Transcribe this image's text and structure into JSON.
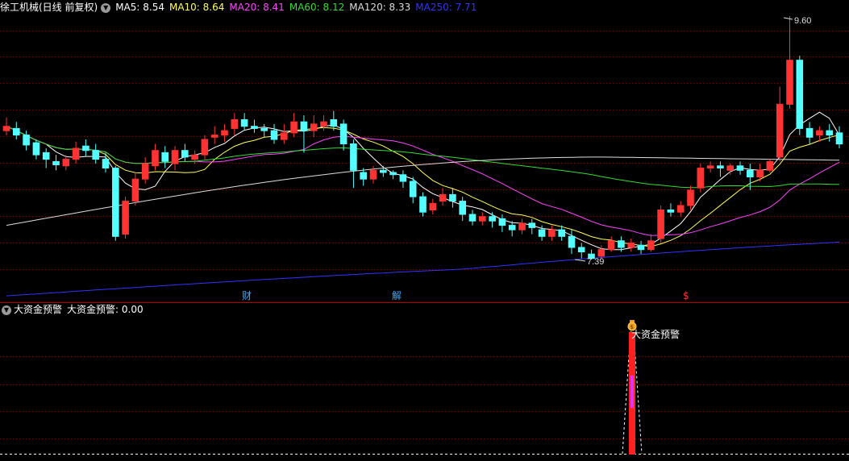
{
  "stock": {
    "title": "徐工机械(日线 前复权)",
    "ma": [
      {
        "label": "MA5: 8.54",
        "color": "#ffffff"
      },
      {
        "label": "MA10: 8.64",
        "color": "#ffff55"
      },
      {
        "label": "MA20: 8.41",
        "color": "#ff44ff"
      },
      {
        "label": "MA60: 8.12",
        "color": "#33dd33"
      },
      {
        "label": "MA120: 8.33",
        "color": "#dddddd"
      },
      {
        "label": "MA250: 7.71",
        "color": "#3333ff"
      }
    ],
    "high_label": "9.60",
    "low_label": "7.39",
    "markers": [
      {
        "text": "财",
        "color": "#3fa8ff"
      },
      {
        "text": "解",
        "color": "#3fa8ff"
      },
      {
        "text": "$",
        "color": "#ff3333"
      }
    ]
  },
  "indicator": {
    "title": "大资金预警",
    "value_label": "大资金预警: 0.00",
    "signal_label": "大资金预警",
    "signal_icon": "money-bag-icon"
  },
  "colors": {
    "up": "#ff3333",
    "down": "#54ffff",
    "grid": "#7a0000",
    "divider": "#b00000"
  },
  "chart_data": {
    "type": "candlestick",
    "price_range": [
      7.2,
      9.7
    ],
    "candles": [
      [
        8.56,
        8.6,
        8.68,
        8.52
      ],
      [
        8.58,
        8.52,
        8.64,
        8.48
      ],
      [
        8.52,
        8.43,
        8.56,
        8.38
      ],
      [
        8.45,
        8.34,
        8.48,
        8.3
      ],
      [
        8.36,
        8.3,
        8.4,
        8.22
      ],
      [
        8.28,
        8.25,
        8.34,
        8.2
      ],
      [
        8.24,
        8.3,
        8.34,
        8.2
      ],
      [
        8.3,
        8.4,
        8.46,
        8.26
      ],
      [
        8.42,
        8.38,
        8.48,
        8.33
      ],
      [
        8.38,
        8.3,
        8.44,
        8.26
      ],
      [
        8.3,
        8.22,
        8.36,
        8.18
      ],
      [
        8.22,
        7.6,
        8.24,
        7.56
      ],
      [
        7.62,
        7.92,
        7.96,
        7.58
      ],
      [
        7.92,
        8.12,
        8.18,
        7.88
      ],
      [
        8.12,
        8.26,
        8.32,
        8.08
      ],
      [
        8.24,
        8.38,
        8.44,
        8.2
      ],
      [
        8.36,
        8.28,
        8.42,
        8.22
      ],
      [
        8.26,
        8.38,
        8.42,
        8.2
      ],
      [
        8.38,
        8.32,
        8.44,
        8.28
      ],
      [
        8.3,
        8.34,
        8.38,
        8.26
      ],
      [
        8.34,
        8.48,
        8.52,
        8.3
      ],
      [
        8.5,
        8.52,
        8.6,
        8.44
      ],
      [
        8.52,
        8.56,
        8.62,
        8.46
      ],
      [
        8.58,
        8.66,
        8.72,
        8.52
      ],
      [
        8.66,
        8.6,
        8.72,
        8.56
      ],
      [
        8.6,
        8.58,
        8.66,
        8.54
      ],
      [
        8.58,
        8.56,
        8.62,
        8.5
      ],
      [
        8.56,
        8.48,
        8.62,
        8.44
      ],
      [
        8.48,
        8.54,
        8.62,
        8.44
      ],
      [
        8.54,
        8.64,
        8.72,
        8.5
      ],
      [
        8.64,
        8.56,
        8.7,
        8.36
      ],
      [
        8.56,
        8.62,
        8.7,
        8.5
      ],
      [
        8.6,
        8.64,
        8.7,
        8.56
      ],
      [
        8.66,
        8.6,
        8.74,
        8.56
      ],
      [
        8.62,
        8.44,
        8.66,
        8.38
      ],
      [
        8.44,
        8.2,
        8.48,
        8.04
      ],
      [
        8.18,
        8.12,
        8.22,
        8.06
      ],
      [
        8.12,
        8.2,
        8.24,
        8.08
      ],
      [
        8.2,
        8.18,
        8.24,
        8.14
      ],
      [
        8.18,
        8.16,
        8.2,
        8.12
      ],
      [
        8.16,
        8.1,
        8.2,
        8.04
      ],
      [
        8.1,
        7.96,
        8.14,
        7.9
      ],
      [
        7.96,
        7.82,
        8.0,
        7.78
      ],
      [
        7.84,
        7.9,
        7.94,
        7.8
      ],
      [
        7.92,
        7.98,
        8.04,
        7.88
      ],
      [
        7.98,
        7.92,
        8.04,
        7.86
      ],
      [
        7.92,
        7.8,
        7.96,
        7.74
      ],
      [
        7.8,
        7.74,
        7.84,
        7.7
      ],
      [
        7.74,
        7.78,
        7.82,
        7.7
      ],
      [
        7.78,
        7.74,
        7.82,
        7.68
      ],
      [
        7.76,
        7.7,
        7.8,
        7.64
      ],
      [
        7.7,
        7.66,
        7.74,
        7.6
      ],
      [
        7.66,
        7.72,
        7.76,
        7.62
      ],
      [
        7.72,
        7.68,
        7.76,
        7.62
      ],
      [
        7.66,
        7.6,
        7.7,
        7.56
      ],
      [
        7.6,
        7.66,
        7.7,
        7.56
      ],
      [
        7.66,
        7.6,
        7.7,
        7.56
      ],
      [
        7.6,
        7.5,
        7.66,
        7.44
      ],
      [
        7.5,
        7.46,
        7.54,
        7.4
      ],
      [
        7.44,
        7.4,
        7.48,
        7.39
      ],
      [
        7.42,
        7.48,
        7.52,
        7.4
      ],
      [
        7.48,
        7.56,
        7.6,
        7.46
      ],
      [
        7.56,
        7.5,
        7.6,
        7.46
      ],
      [
        7.5,
        7.54,
        7.58,
        7.46
      ],
      [
        7.52,
        7.48,
        7.56,
        7.44
      ],
      [
        7.48,
        7.56,
        7.62,
        7.46
      ],
      [
        7.58,
        7.84,
        7.88,
        7.54
      ],
      [
        7.84,
        7.82,
        7.9,
        7.78
      ],
      [
        7.82,
        7.88,
        7.92,
        7.78
      ],
      [
        7.88,
        8.02,
        8.06,
        7.84
      ],
      [
        8.04,
        8.22,
        8.26,
        8.0
      ],
      [
        8.22,
        8.24,
        8.28,
        8.18
      ],
      [
        8.24,
        8.22,
        8.28,
        8.14
      ],
      [
        8.2,
        8.24,
        8.26,
        8.16
      ],
      [
        8.24,
        8.2,
        8.28,
        8.16
      ],
      [
        8.2,
        8.14,
        8.26,
        8.02
      ],
      [
        8.14,
        8.2,
        8.26,
        8.1
      ],
      [
        8.2,
        8.28,
        8.3,
        8.18
      ],
      [
        8.32,
        8.8,
        8.96,
        8.28
      ],
      [
        8.8,
        9.2,
        9.6,
        8.76
      ],
      [
        9.2,
        8.58,
        9.24,
        8.52
      ],
      [
        8.58,
        8.5,
        8.64,
        8.44
      ],
      [
        8.52,
        8.56,
        8.6,
        8.46
      ],
      [
        8.56,
        8.52,
        8.62,
        8.46
      ],
      [
        8.54,
        8.44,
        8.6,
        8.4
      ]
    ],
    "signal_bar_index": 78,
    "indicator_value": 0.0
  }
}
